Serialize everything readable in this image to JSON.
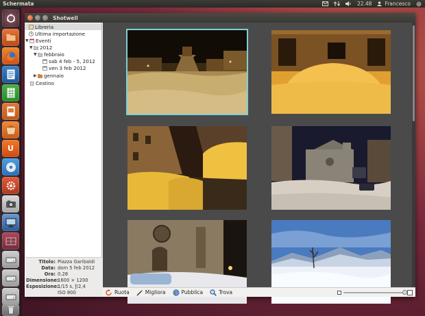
{
  "top_panel": {
    "app_name": "Schermata",
    "time": "22.48",
    "user": "Francesco"
  },
  "window": {
    "title": "Shotwell"
  },
  "sidebar": {
    "library": "Libreria",
    "last_import": "Ultima importazione",
    "events": "Eventi",
    "year": "2012",
    "month_feb": "febbraio",
    "event_1": "sab 4 feb - 5, 2012",
    "event_2": "ven 3 feb 2012",
    "month_jan": "gennaio",
    "trash": "Cestino"
  },
  "metadata": {
    "title_label": "Titolo:",
    "title_value": "Piazza Garibaldi",
    "date_label": "Data:",
    "date_value": "dom 5 feb 2012",
    "time_label": "Ora:",
    "time_value": "0.28",
    "dimension_label": "Dimensione:",
    "dimension_value": "1600 × 1200",
    "exposure_label": "Esposizione:",
    "exposure_value": "1/15 s, ƒ/2,4",
    "iso_value": "ISO 800"
  },
  "toolbar": {
    "rotate": "Ruota",
    "enhance": "Migliora",
    "publish": "Pubblica",
    "find": "Trova"
  },
  "colors": {
    "accent_selection": "#7fd0d6",
    "ubuntu_orange": "#dd4814"
  }
}
